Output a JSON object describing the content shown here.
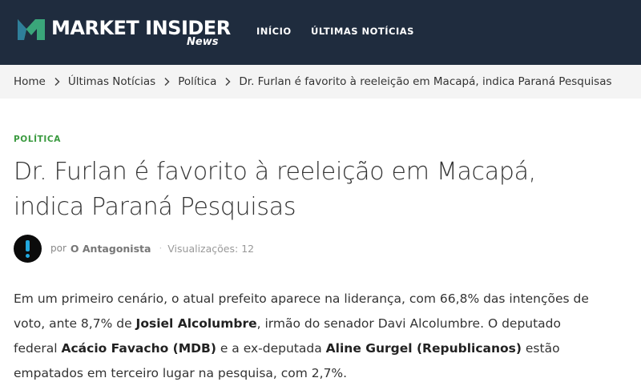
{
  "header": {
    "logo_text": "MARKET INSIDER",
    "logo_sub": "News",
    "brand_colors": {
      "dark": "#1f2c3e",
      "green": "#3aa67a",
      "teal": "#2f7f9a"
    },
    "nav": [
      {
        "label": "INÍCIO"
      },
      {
        "label": "ÚLTIMAS NOTÍCIAS"
      }
    ]
  },
  "breadcrumb": {
    "items": [
      "Home",
      "Últimas Notícias",
      "Política"
    ],
    "current": "Dr. Furlan é favorito à reeleição em Macapá, indica Paraná Pesquisas",
    "separator_icon": "chevron-right-icon"
  },
  "article": {
    "category": "POLÍTICA",
    "category_color": "#3a9a3f",
    "title": "Dr. Furlan é favorito à reeleição em Macapá, indica Paraná Pesquisas",
    "meta": {
      "by": "por",
      "author": "O Antagonista",
      "views_label": "Visualizações:",
      "views_count": "12",
      "avatar_icon": "exclamation-icon",
      "avatar_accent": "#22a9e0"
    },
    "paragraph": {
      "t1": "Em um primeiro cenário, o atual prefeito aparece na liderança, com 66,8% das intenções de voto, ante 8,7% de ",
      "b1": "Josiel Alcolumbre",
      "t2": ", irmão do senador Davi Alcolumbre. O deputado federal ",
      "b2": "Acácio Favacho (MDB)",
      "t3": " e a ex-deputada ",
      "b3": "Aline Gurgel (Republicanos)",
      "t4": " estão empatados em terceiro lugar na pesquisa, com 2,7%."
    }
  }
}
